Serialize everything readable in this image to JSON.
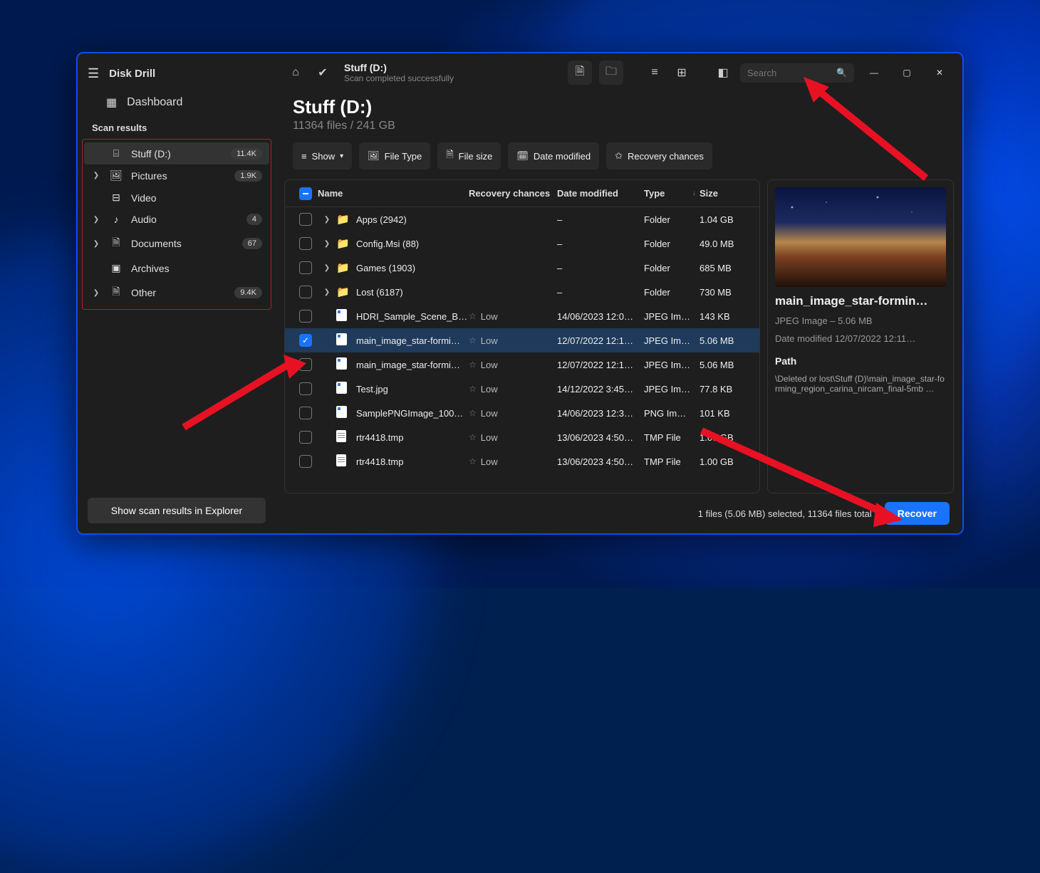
{
  "app": {
    "name": "Disk Drill",
    "dashboard": "Dashboard",
    "scan_results_hd": "Scan results"
  },
  "sidebar": {
    "items": [
      {
        "label": "Stuff (D:)",
        "badge": "11.4K",
        "selected": true,
        "has_children": false,
        "icon": "drive"
      },
      {
        "label": "Pictures",
        "badge": "1.9K",
        "selected": false,
        "has_children": true,
        "icon": "image"
      },
      {
        "label": "Video",
        "badge": "",
        "selected": false,
        "has_children": false,
        "icon": "video"
      },
      {
        "label": "Audio",
        "badge": "4",
        "selected": false,
        "has_children": true,
        "icon": "audio"
      },
      {
        "label": "Documents",
        "badge": "67",
        "selected": false,
        "has_children": true,
        "icon": "doc"
      },
      {
        "label": "Archives",
        "badge": "",
        "selected": false,
        "has_children": false,
        "icon": "archive"
      },
      {
        "label": "Other",
        "badge": "9.4K",
        "selected": false,
        "has_children": true,
        "icon": "other"
      }
    ],
    "bottom_btn": "Show scan results in Explorer"
  },
  "topbar": {
    "title": "Stuff (D:)",
    "subtitle": "Scan completed successfully",
    "search_placeholder": "Search"
  },
  "page": {
    "title": "Stuff (D:)",
    "meta": "11364 files / 241 GB"
  },
  "filters": {
    "show": "Show",
    "filetype": "File Type",
    "filesize": "File size",
    "date": "Date modified",
    "recovery": "Recovery chances"
  },
  "columns": {
    "name": "Name",
    "recovery": "Recovery chances",
    "date": "Date modified",
    "type": "Type",
    "size": "Size"
  },
  "rows": [
    {
      "folder": true,
      "name": "Apps (2942)",
      "recovery": "",
      "date": "–",
      "type": "Folder",
      "size": "1.04 GB",
      "selected": false
    },
    {
      "folder": true,
      "name": "Config.Msi (88)",
      "recovery": "",
      "date": "–",
      "type": "Folder",
      "size": "49.0 MB",
      "selected": false
    },
    {
      "folder": true,
      "name": "Games (1903)",
      "recovery": "",
      "date": "–",
      "type": "Folder",
      "size": "685 MB",
      "selected": false
    },
    {
      "folder": true,
      "name": "Lost (6187)",
      "recovery": "",
      "date": "–",
      "type": "Folder",
      "size": "730 MB",
      "selected": false
    },
    {
      "folder": false,
      "name": "HDRI_Sample_Scene_B…",
      "recovery": "Low",
      "date": "14/06/2023 12:0…",
      "type": "JPEG Im…",
      "size": "143 KB",
      "selected": false,
      "ic": "doc"
    },
    {
      "folder": false,
      "name": "main_image_star-formi…",
      "recovery": "Low",
      "date": "12/07/2022 12:1…",
      "type": "JPEG Im…",
      "size": "5.06 MB",
      "selected": true,
      "ic": "doc"
    },
    {
      "folder": false,
      "name": "main_image_star-formi…",
      "recovery": "Low",
      "date": "12/07/2022 12:1…",
      "type": "JPEG Im…",
      "size": "5.06 MB",
      "selected": false,
      "ic": "doc"
    },
    {
      "folder": false,
      "name": "Test.jpg",
      "recovery": "Low",
      "date": "14/12/2022 3:45…",
      "type": "JPEG Im…",
      "size": "77.8 KB",
      "selected": false,
      "ic": "doc"
    },
    {
      "folder": false,
      "name": "SamplePNGImage_100…",
      "recovery": "Low",
      "date": "14/06/2023 12:3…",
      "type": "PNG Im…",
      "size": "101 KB",
      "selected": false,
      "ic": "doc"
    },
    {
      "folder": false,
      "name": "rtr4418.tmp",
      "recovery": "Low",
      "date": "13/06/2023 4:50…",
      "type": "TMP File",
      "size": "1.00 GB",
      "selected": false,
      "ic": "page"
    },
    {
      "folder": false,
      "name": "rtr4418.tmp",
      "recovery": "Low",
      "date": "13/06/2023 4:50…",
      "type": "TMP File",
      "size": "1.00 GB",
      "selected": false,
      "ic": "page"
    }
  ],
  "preview": {
    "title": "main_image_star-formin…",
    "type_line": "JPEG Image – 5.06 MB",
    "date_line": "Date modified 12/07/2022 12:11…",
    "path_hd": "Path",
    "path": "\\Deleted or lost\\Stuff (D)\\main_image_star-forming_region_carina_nircam_final-5mb …"
  },
  "footer": {
    "status": "1 files (5.06 MB) selected, 11364 files total",
    "recover": "Recover"
  }
}
